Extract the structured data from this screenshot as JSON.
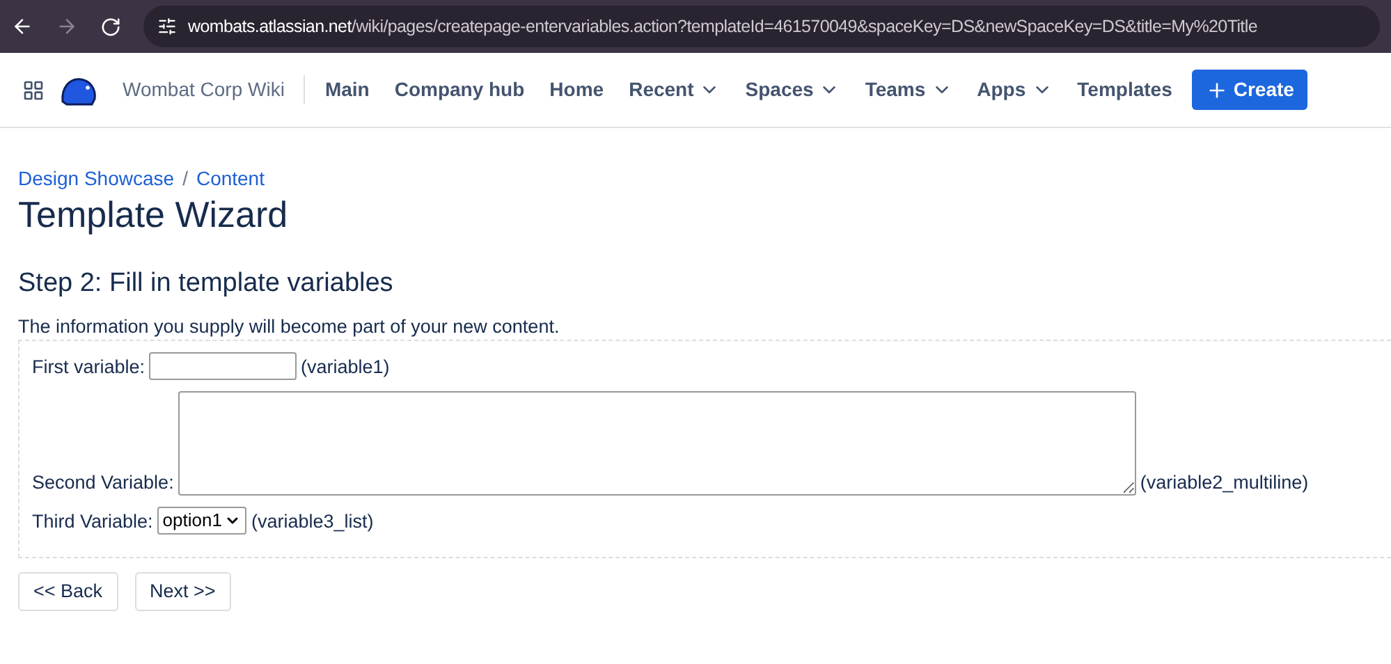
{
  "browser": {
    "url_domain": "wombats.atlassian.net",
    "url_path": "/wiki/pages/createpage-entervariables.action?templateId=461570049&spaceKey=DS&newSpaceKey=DS&title=My%20Title",
    "forward_disabled": true
  },
  "nav": {
    "site_name": "Wombat Corp Wiki",
    "items": [
      {
        "label": "Main",
        "kind": "link"
      },
      {
        "label": "Company hub",
        "kind": "link"
      },
      {
        "label": "Home",
        "kind": "link"
      },
      {
        "label": "Recent",
        "kind": "dropdown"
      },
      {
        "label": "Spaces",
        "kind": "dropdown"
      },
      {
        "label": "Teams",
        "kind": "dropdown"
      },
      {
        "label": "Apps",
        "kind": "dropdown"
      },
      {
        "label": "Templates",
        "kind": "link"
      }
    ],
    "create_button": "Create"
  },
  "breadcrumbs": [
    "Design Showcase",
    "Content"
  ],
  "breadcrumb_separator": "/",
  "title": "Template Wizard",
  "step_heading": "Step 2: Fill in template variables",
  "intro": "The information you supply will become part of your new content.",
  "variables": [
    {
      "label": "First variable:",
      "kind": "text",
      "hint": "(variable1)"
    },
    {
      "label": "Second Variable:",
      "kind": "multiline",
      "hint": "(variable2_multiline)"
    },
    {
      "label": "Third Variable:",
      "kind": "select",
      "value": "option1",
      "hint": "(variable3_list)"
    }
  ],
  "buttons": [
    "<< Back",
    "Next >>"
  ]
}
